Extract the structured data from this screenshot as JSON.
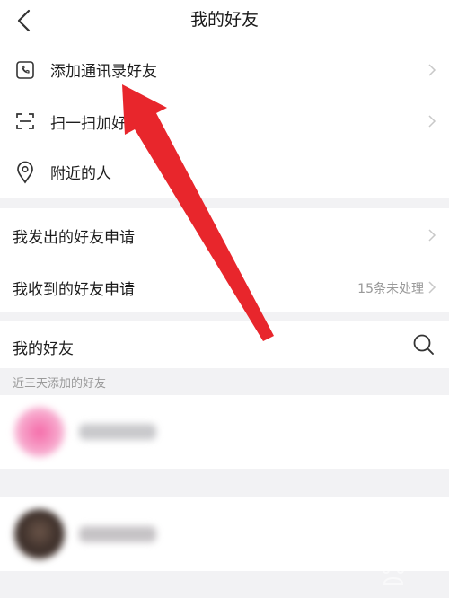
{
  "header": {
    "title": "我的好友",
    "back_icon": "chevron-left-icon"
  },
  "menu_top": [
    {
      "label": "添加通讯录好友",
      "icon": "phone-book-icon"
    },
    {
      "label": "扫一扫加好",
      "icon": "scan-icon"
    },
    {
      "label": "附近的人",
      "icon": "location-pin-icon"
    }
  ],
  "requests": {
    "sent_label": "我发出的好友申请",
    "received_label": "我收到的好友申请",
    "received_meta": "15条未处理"
  },
  "friends": {
    "title": "我的好友",
    "search_icon": "search-icon",
    "recent_label": "近三天添加的好友"
  },
  "colors": {
    "background": "#f2f2f4",
    "card": "#ffffff",
    "accent_arrow": "#e8262c",
    "muted_text": "#999999"
  }
}
